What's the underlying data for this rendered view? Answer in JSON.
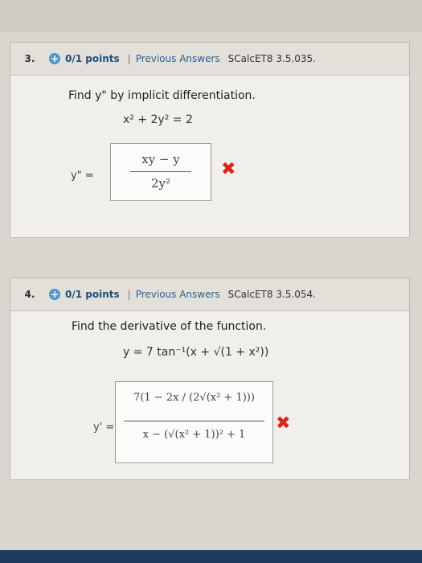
{
  "q3": {
    "number": "3.",
    "points": "0/1 points",
    "separator": "|",
    "previous_answers": "Previous Answers",
    "code": "SCalcET8 3.5.035.",
    "prompt": "Find y\" by implicit differentiation.",
    "equation": "x² + 2y² = 2",
    "answer_label": "y\" =",
    "answer_numerator": "xy − y",
    "answer_denominator": "2y²",
    "result": "incorrect"
  },
  "q4": {
    "number": "4.",
    "points": "0/1 points",
    "separator": "|",
    "previous_answers": "Previous Answers",
    "code": "SCalcET8 3.5.054.",
    "prompt": "Find the derivative of the function.",
    "equation": "y = 7 tan⁻¹(x + √(1 + x²))",
    "answer_label": "y' =",
    "answer_numerator": "7(1 − 2x / (2√(x² + 1)))",
    "answer_denominator": "x − (√(x² + 1))² + 1",
    "result": "incorrect"
  },
  "icons": {
    "plus": "plus-circle-icon",
    "x": "x-mark-icon"
  },
  "colors": {
    "accent": "#4f98c9",
    "error": "#d9261c"
  }
}
